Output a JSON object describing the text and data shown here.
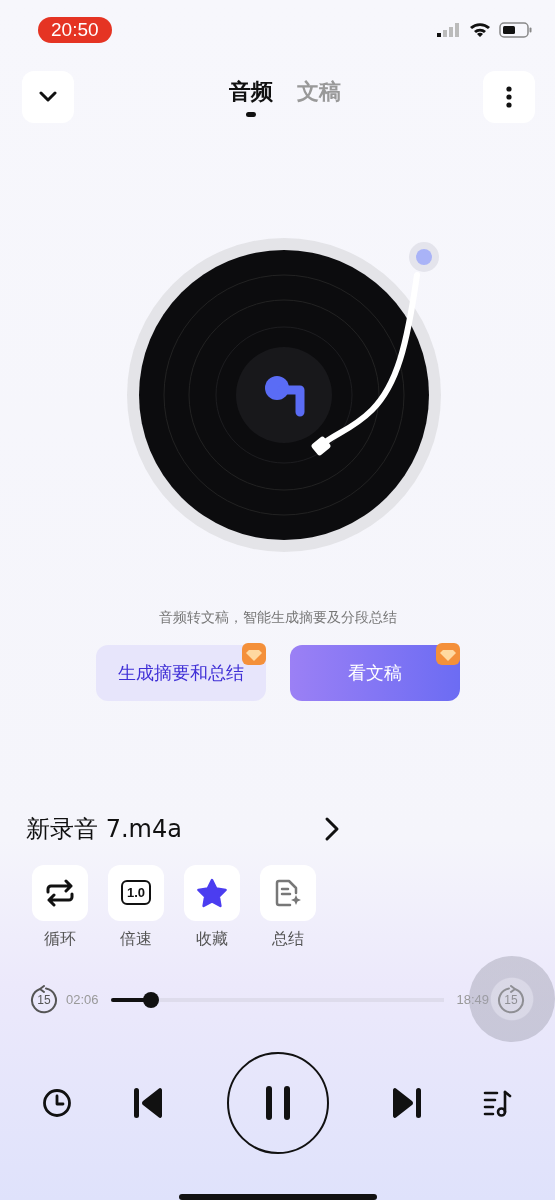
{
  "status_bar": {
    "time": "20:50"
  },
  "tabs": [
    {
      "label": "音频",
      "selected": true
    },
    {
      "label": "文稿",
      "selected": false
    }
  ],
  "caption": "音频转文稿，智能生成摘要及分段总结",
  "buttons": [
    {
      "label": "生成摘要和总结",
      "kind": "secondary"
    },
    {
      "label": "看文稿",
      "kind": "primary"
    }
  ],
  "file": {
    "name": "新录音 7.m4a"
  },
  "actions": [
    {
      "label": "循环",
      "kind": "loop"
    },
    {
      "label": "倍速",
      "kind": "speed",
      "value": "1.0"
    },
    {
      "label": "收藏",
      "kind": "favorite",
      "on": true
    },
    {
      "label": "总结",
      "kind": "summary"
    }
  ],
  "player": {
    "skip_back": "15",
    "elapsed": "02:06",
    "level": 0.12,
    "total": "18:49",
    "skip_forward": "15"
  }
}
